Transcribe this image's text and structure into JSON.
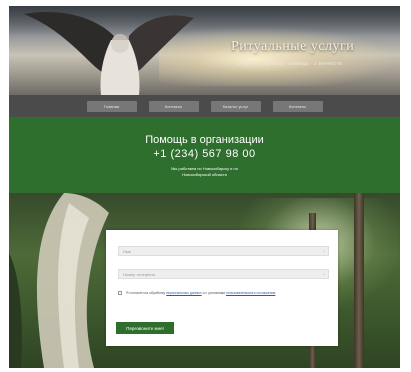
{
  "header": {
    "title": "Ритуальные услуги",
    "subtitle": "Скорбь · бережно · помощь · о вечности"
  },
  "nav": {
    "items": [
      {
        "label": "Главная"
      },
      {
        "label": "Контакты"
      },
      {
        "label": "Каталог услуг"
      },
      {
        "label": "Контакты"
      }
    ]
  },
  "help": {
    "title": "Помощь в организации",
    "phone": "+1 (234) 567 98 00",
    "work_line1": "Мы работаем по Новосибирску и по",
    "work_line2": "Новосибирской области"
  },
  "form": {
    "name_placeholder": "Имя",
    "phone_placeholder": "Номер телефона",
    "consent_prefix": "Я согласен на обработку",
    "consent_link1": "персональных данных",
    "consent_middle": "и с условиями",
    "consent_link2": "пользовательского соглашения",
    "submit_label": "Перезвоните мне!"
  },
  "colors": {
    "green": "#2e6f2e",
    "nav_bg": "#4b4b4b",
    "nav_button": "#777777"
  }
}
